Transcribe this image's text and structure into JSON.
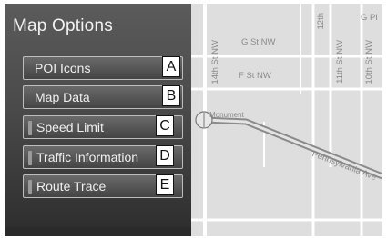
{
  "menu": {
    "title": "Map Options",
    "items": [
      {
        "label": "POI Icons",
        "tag": "A"
      },
      {
        "label": "Map Data",
        "tag": "B"
      },
      {
        "label": "Speed Limit",
        "tag": "C"
      },
      {
        "label": "Traffic Information",
        "tag": "D"
      },
      {
        "label": "Route Trace",
        "tag": "E"
      }
    ]
  },
  "map": {
    "streets": {
      "g_st": "G St NW",
      "f_st": "F St NW",
      "st14": "14th St NW",
      "st11": "11th St NW",
      "st10": "10th St NW",
      "st12": "12th",
      "g_pl": "G Pl",
      "monument": "Monument",
      "penn": "Pennsylvania Ave"
    }
  }
}
